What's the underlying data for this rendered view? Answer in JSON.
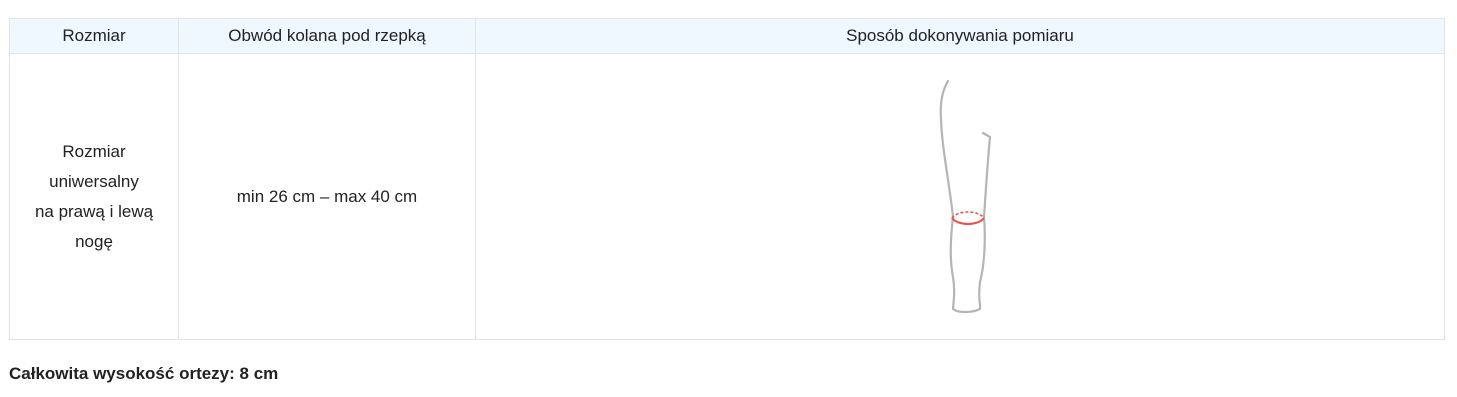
{
  "table": {
    "headers": [
      "Rozmiar",
      "Obwód kolana pod rzepką",
      "Sposób dokonywania pomiaru"
    ],
    "row": {
      "size_lines": [
        "Rozmiar",
        "uniwersalny",
        "na prawą i lewą",
        "nogę"
      ],
      "circumference": "min 26 cm – max 40 cm",
      "measure_figure": "leg-outline-with-knee-measurement-icon"
    }
  },
  "footer": {
    "note": "Całkowita wysokość ortezy: 8 cm"
  },
  "colors": {
    "header_bg": "#eff7ff",
    "border": "#e3e3e3",
    "leg_outline": "#b5b5b5",
    "measure_line": "#e8534a"
  }
}
